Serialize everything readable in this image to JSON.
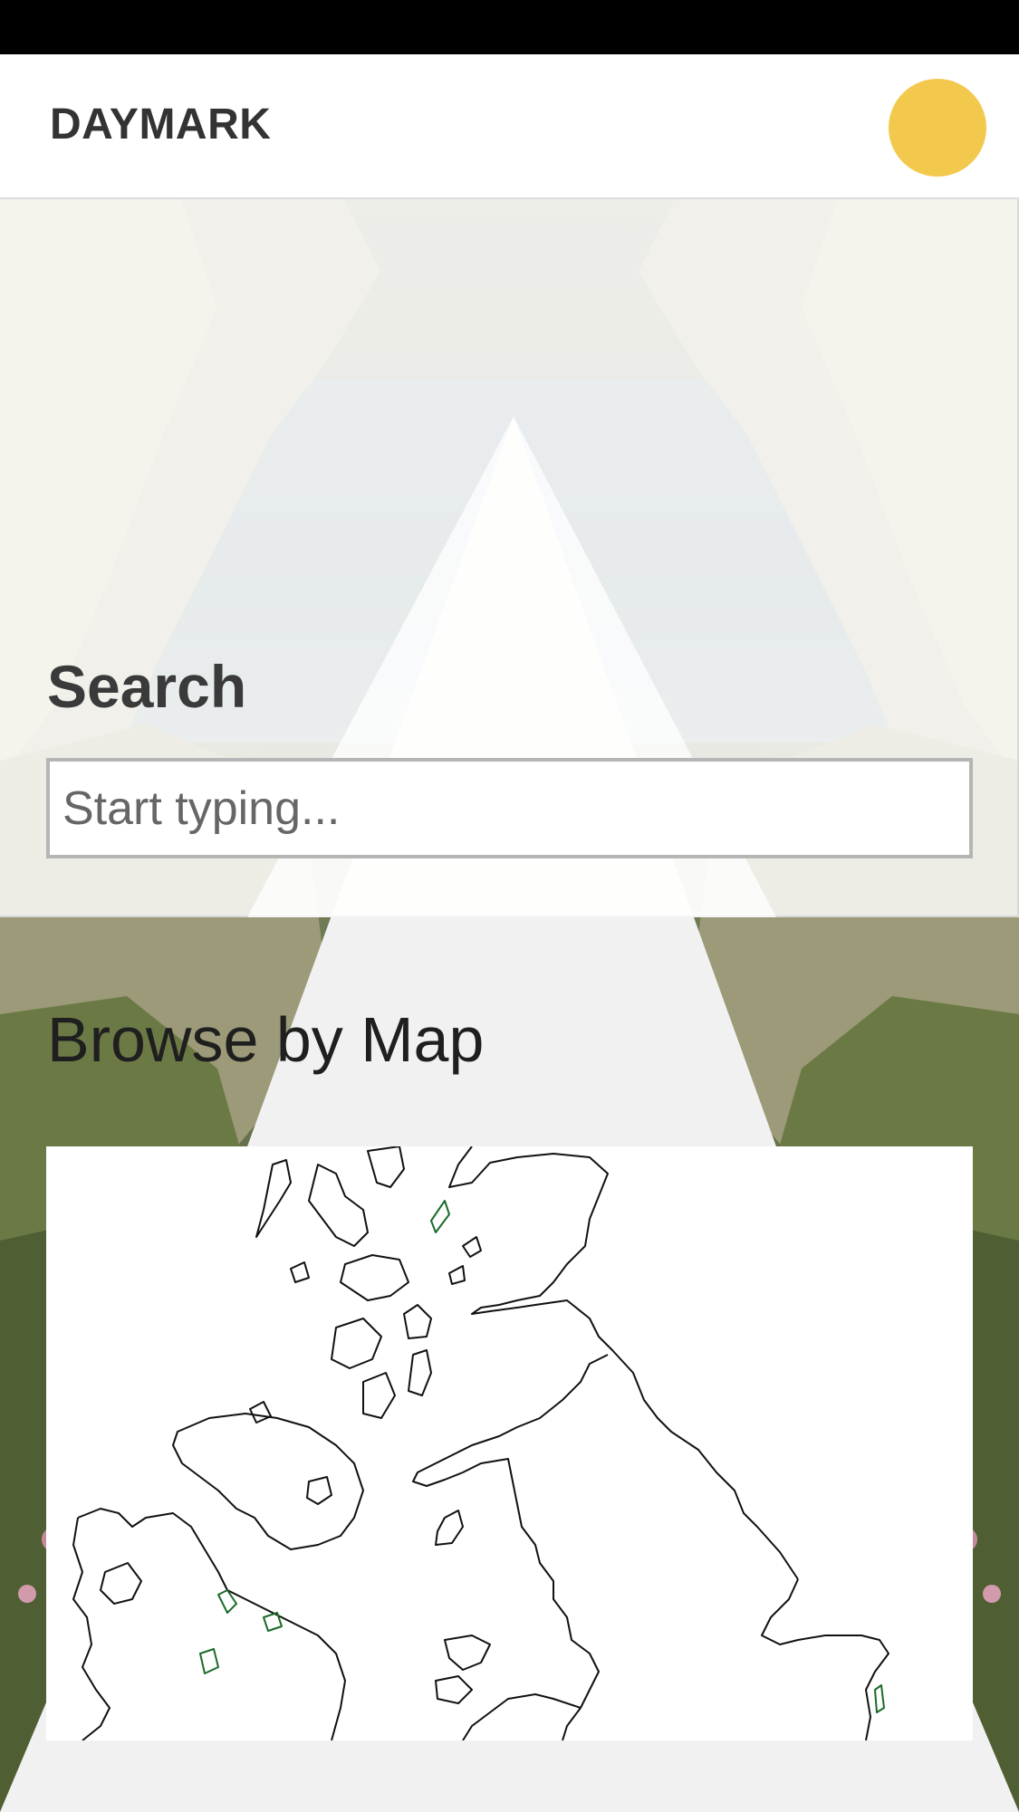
{
  "app": {
    "brand": "DAYMARK",
    "accent_color": "#f2c94c"
  },
  "header": {
    "avatar_icon": "user-avatar-icon"
  },
  "search": {
    "title": "Search",
    "placeholder": "Start typing..."
  },
  "browse": {
    "title": "Browse by Map",
    "map_icon": "uk-map"
  }
}
